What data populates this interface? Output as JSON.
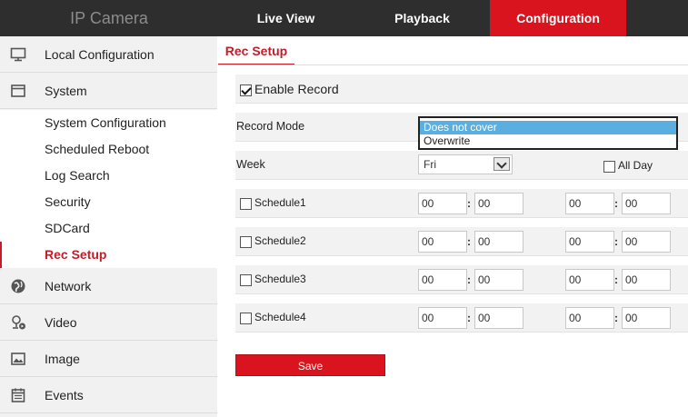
{
  "header": {
    "app_title": "IP Camera",
    "nav": {
      "live_view": "Live View",
      "playback": "Playback",
      "configuration": "Configuration"
    },
    "active_nav": "configuration"
  },
  "sidebar": {
    "items": {
      "local_configuration": {
        "label": "Local Configuration",
        "icon": "monitor-icon"
      },
      "system": {
        "label": "System",
        "icon": "window-icon"
      },
      "network": {
        "label": "Network",
        "icon": "globe-icon"
      },
      "video": {
        "label": "Video",
        "icon": "camera-icon"
      },
      "image": {
        "label": "Image",
        "icon": "image-icon"
      },
      "events": {
        "label": "Events",
        "icon": "calendar-icon"
      }
    },
    "system_sub_items": [
      "System Configuration",
      "Scheduled Reboot",
      "Log Search",
      "Security",
      "SDCard",
      "Rec Setup"
    ],
    "active_sub_item": "Rec Setup"
  },
  "main": {
    "tab_title": "Rec Setup",
    "enable_record": {
      "label": "Enable Record",
      "checked": true
    },
    "record_mode": {
      "label": "Record Mode",
      "options": [
        "Does not cover",
        "Overwrite"
      ],
      "highlighted": "Does not cover"
    },
    "week": {
      "label": "Week",
      "value": "Fri",
      "all_day_label": "All Day",
      "all_day_checked": false
    },
    "schedules": [
      {
        "label": "Schedule1",
        "checked": false,
        "start_h": "00",
        "start_m": "00",
        "end_h": "00",
        "end_m": "00"
      },
      {
        "label": "Schedule2",
        "checked": false,
        "start_h": "00",
        "start_m": "00",
        "end_h": "00",
        "end_m": "00"
      },
      {
        "label": "Schedule3",
        "checked": false,
        "start_h": "00",
        "start_m": "00",
        "end_h": "00",
        "end_m": "00"
      },
      {
        "label": "Schedule4",
        "checked": false,
        "start_h": "00",
        "start_m": "00",
        "end_h": "00",
        "end_m": "00"
      }
    ],
    "time_separator": ":",
    "save_label": "Save"
  },
  "colors": {
    "accent_red": "#d9141e",
    "header_dark": "#2e2e2e",
    "highlight_blue": "#5aaee0"
  }
}
